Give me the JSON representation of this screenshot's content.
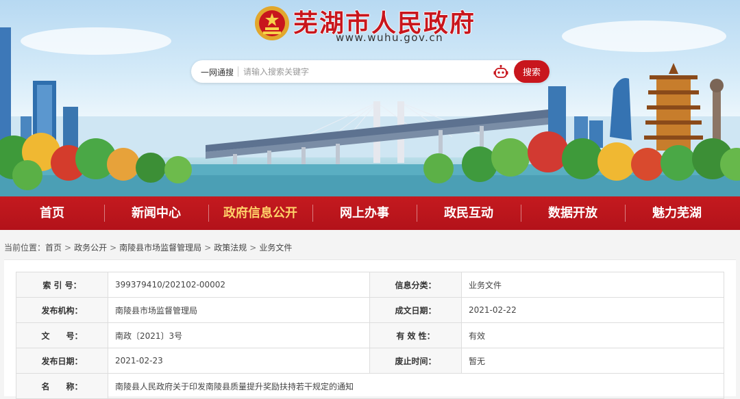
{
  "header": {
    "title": "芜湖市人民政府",
    "domain": "www.wuhu.gov.cn"
  },
  "search": {
    "scope_label": "一网通搜",
    "placeholder": "请输入搜索关键字",
    "button_label": "搜索"
  },
  "nav": {
    "items": [
      {
        "label": "首页"
      },
      {
        "label": "新闻中心"
      },
      {
        "label": "政府信息公开"
      },
      {
        "label": "网上办事"
      },
      {
        "label": "政民互动"
      },
      {
        "label": "数据开放"
      },
      {
        "label": "魅力芜湖"
      }
    ],
    "active_index": 2
  },
  "breadcrumb": {
    "prefix": "当前位置：",
    "items": [
      "首页",
      "政务公开",
      "南陵县市场监督管理局",
      "政策法规",
      "业务文件"
    ],
    "separator": ">"
  },
  "info_table": {
    "rows": [
      {
        "label1": "索 引 号：",
        "value1": "399379410/202102-00002",
        "label2": "信息分类：",
        "value2": "业务文件"
      },
      {
        "label1": "发布机构：",
        "value1": "南陵县市场监督管理局",
        "label2": "成文日期：",
        "value2": "2021-02-22"
      },
      {
        "label1": "文　　号：",
        "value1": "南政〔2021〕3号",
        "label2": "有 效 性：",
        "value2": "有效"
      },
      {
        "label1": "发布日期：",
        "value1": "2021-02-23",
        "label2": "废止时间：",
        "value2": "暂无"
      }
    ],
    "name_label": "名　　称：",
    "name_value": "南陵县人民政府关于印发南陵县质量提升奖励扶持若干规定的通知"
  },
  "colors": {
    "brand_red": "#c8161d",
    "nav_active": "#ffd26a"
  },
  "icons": {
    "emblem": "national-emblem-icon",
    "robot": "robot-assistant-icon"
  }
}
